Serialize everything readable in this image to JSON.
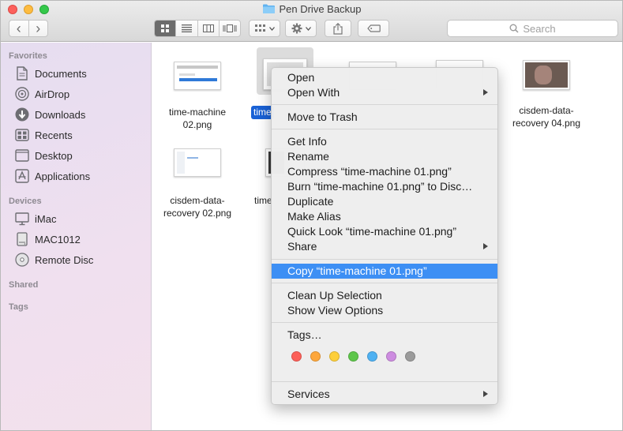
{
  "window": {
    "title": "Pen Drive Backup"
  },
  "toolbar": {
    "back": "‹",
    "forward": "›",
    "view_modes": [
      "icon-view",
      "list-view",
      "column-view",
      "cover-flow-view"
    ],
    "arrange": "arrange",
    "action": "action",
    "share": "share",
    "tags": "tags",
    "search_placeholder": "Search"
  },
  "sidebar": {
    "favorites_heading": "Favorites",
    "favorites": [
      {
        "label": "Documents",
        "icon": "documents-icon"
      },
      {
        "label": "AirDrop",
        "icon": "airdrop-icon"
      },
      {
        "label": "Downloads",
        "icon": "downloads-icon"
      },
      {
        "label": "Recents",
        "icon": "recents-icon"
      },
      {
        "label": "Desktop",
        "icon": "desktop-icon"
      },
      {
        "label": "Applications",
        "icon": "applications-icon"
      }
    ],
    "devices_heading": "Devices",
    "devices": [
      {
        "label": "iMac",
        "icon": "imac-icon"
      },
      {
        "label": "MAC1012",
        "icon": "drive-icon"
      },
      {
        "label": "Remote Disc",
        "icon": "disc-icon"
      }
    ],
    "shared_heading": "Shared",
    "tags_heading": "Tags"
  },
  "files": [
    {
      "line1": "time-machine",
      "line2": "02.png"
    },
    {
      "line1": "time-machine 01.png",
      "line2": ""
    },
    {
      "line1": "",
      "line2": ""
    },
    {
      "line1": "",
      "line2": ""
    },
    {
      "line1": "cisdem-data-",
      "line2": "recovery 04.png"
    },
    {
      "line1": "cisdem-data-",
      "line2": "recovery 02.png"
    },
    {
      "line1": "time",
      "line2": ""
    }
  ],
  "selected_label": "time",
  "context_menu": {
    "open": "Open",
    "open_with": "Open With",
    "move_to_trash": "Move to Trash",
    "get_info": "Get Info",
    "rename": "Rename",
    "compress": "Compress “time-machine 01.png”",
    "burn": "Burn “time-machine 01.png” to Disc…",
    "duplicate": "Duplicate",
    "make_alias": "Make Alias",
    "quick_look": "Quick Look “time-machine 01.png”",
    "share": "Share",
    "copy": "Copy “time-machine 01.png”",
    "clean_up": "Clean Up Selection",
    "show_view_options": "Show View Options",
    "tags": "Tags…",
    "tag_colors": [
      "#fc5f58",
      "#fda73c",
      "#fdcf3a",
      "#5ec64b",
      "#4fb1f2",
      "#cd8ce0",
      "#9b9b9b"
    ],
    "services": "Services"
  },
  "colors": {
    "highlight": "#3d8ff4",
    "selection": "#1a62d6"
  }
}
